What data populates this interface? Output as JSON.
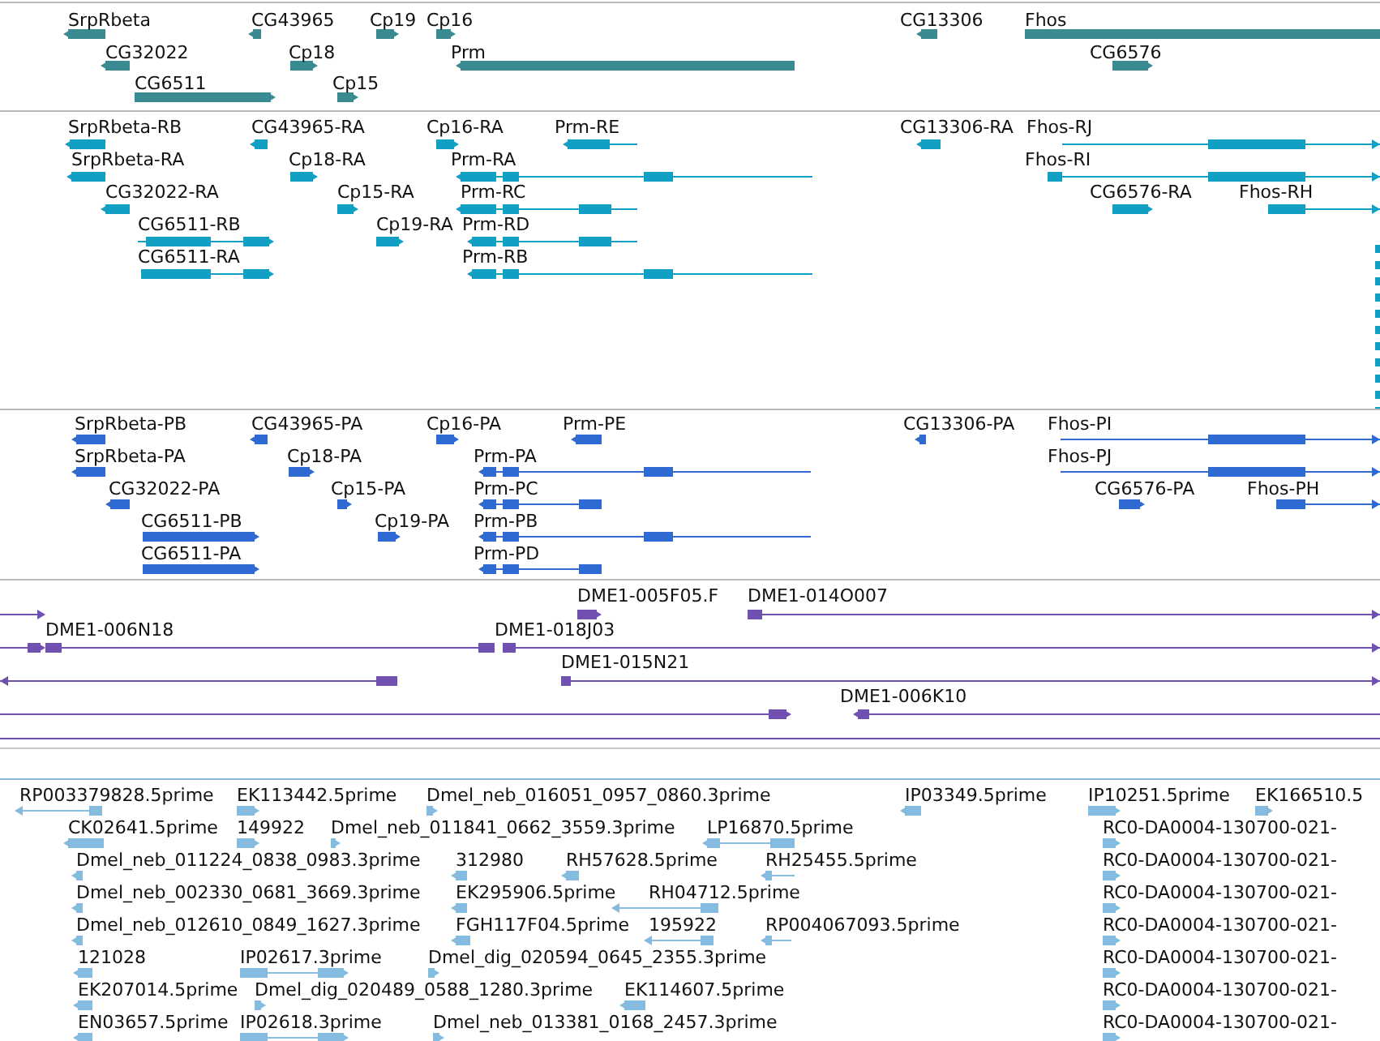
{
  "tracks": [
    {
      "color": "#3a8a92",
      "features": [
        {
          "label": "SrpRbeta",
          "reverse": true
        },
        {
          "label": "CG43965",
          "reverse": true
        },
        {
          "label": "Cp19",
          "reverse": false
        },
        {
          "label": "Cp16",
          "reverse": false
        },
        {
          "label": "CG13306",
          "reverse": true
        },
        {
          "label": "Fhos",
          "reverse": false
        },
        {
          "label": "CG32022",
          "reverse": true
        },
        {
          "label": "Cp18",
          "reverse": false
        },
        {
          "label": "Prm",
          "reverse": true
        },
        {
          "label": "CG6576",
          "reverse": false
        },
        {
          "label": "CG6511",
          "reverse": false
        },
        {
          "label": "Cp15",
          "reverse": false
        }
      ]
    },
    {
      "color": "#119fc4",
      "features": [
        {
          "label": "SrpRbeta-RB",
          "reverse": true
        },
        {
          "label": "CG43965-RA",
          "reverse": true
        },
        {
          "label": "Cp16-RA",
          "reverse": false
        },
        {
          "label": "Prm-RE",
          "reverse": true
        },
        {
          "label": "CG13306-RA",
          "reverse": true
        },
        {
          "label": "Fhos-RJ",
          "reverse": false
        },
        {
          "label": "SrpRbeta-RA",
          "reverse": true
        },
        {
          "label": "Cp18-RA",
          "reverse": false
        },
        {
          "label": "Prm-RA",
          "reverse": true
        },
        {
          "label": "Fhos-RI",
          "reverse": false
        },
        {
          "label": "CG32022-RA",
          "reverse": true
        },
        {
          "label": "Cp15-RA",
          "reverse": false
        },
        {
          "label": "Prm-RC",
          "reverse": true
        },
        {
          "label": "CG6576-RA",
          "reverse": false
        },
        {
          "label": "Fhos-RH",
          "reverse": false
        },
        {
          "label": "CG6511-RB",
          "reverse": false
        },
        {
          "label": "Cp19-RA",
          "reverse": false
        },
        {
          "label": "Prm-RD",
          "reverse": true
        },
        {
          "label": "CG6511-RA",
          "reverse": false
        },
        {
          "label": "Prm-RB",
          "reverse": true
        }
      ]
    },
    {
      "color": "#2f6ad2",
      "features": [
        {
          "label": "SrpRbeta-PB",
          "reverse": true
        },
        {
          "label": "CG43965-PA",
          "reverse": true
        },
        {
          "label": "Cp16-PA",
          "reverse": false
        },
        {
          "label": "Prm-PE",
          "reverse": true
        },
        {
          "label": "CG13306-PA",
          "reverse": true
        },
        {
          "label": "Fhos-PI",
          "reverse": false
        },
        {
          "label": "SrpRbeta-PA",
          "reverse": true
        },
        {
          "label": "Cp18-PA",
          "reverse": false
        },
        {
          "label": "Prm-PA",
          "reverse": true
        },
        {
          "label": "Fhos-PJ",
          "reverse": false
        },
        {
          "label": "CG32022-PA",
          "reverse": true
        },
        {
          "label": "Cp15-PA",
          "reverse": false
        },
        {
          "label": "Prm-PC",
          "reverse": true
        },
        {
          "label": "CG6576-PA",
          "reverse": false
        },
        {
          "label": "Fhos-PH",
          "reverse": false
        },
        {
          "label": "CG6511-PB",
          "reverse": false
        },
        {
          "label": "Cp19-PA",
          "reverse": false
        },
        {
          "label": "Prm-PB",
          "reverse": true
        },
        {
          "label": "CG6511-PA",
          "reverse": false
        },
        {
          "label": "Prm-PD",
          "reverse": true
        }
      ]
    },
    {
      "color": "#7050b0",
      "features": [
        {
          "reverse": false
        },
        {
          "label": "DME1-005F05.F",
          "reverse": false
        },
        {
          "label": "DME1-014O007",
          "reverse": false
        },
        {
          "reverse": false
        },
        {
          "label": "DME1-006N18",
          "reverse": false
        },
        {
          "label": "DME1-018J03",
          "reverse": false
        },
        {
          "reverse": true
        },
        {
          "label": "DME1-015N21",
          "reverse": false
        },
        {
          "reverse": false
        },
        {
          "label": "DME1-006K10",
          "reverse": true
        }
      ]
    },
    {
      "color": "#86bbe0",
      "features": [
        {
          "label": "RP003379828.5prime",
          "reverse": true
        },
        {
          "label": "EK113442.5prime",
          "reverse": false
        },
        {
          "label": "Dmel_neb_016051_0957_0860.3prime",
          "reverse": false
        },
        {
          "label": "IP03349.5prime",
          "reverse": true
        },
        {
          "label": "IP10251.5prime",
          "reverse": false
        },
        {
          "label": "EK166510.5",
          "reverse": false
        },
        {
          "label": "CK02641.5prime",
          "reverse": true
        },
        {
          "label": "149922",
          "reverse": false
        },
        {
          "label": "Dmel_neb_011841_0662_3559.3prime",
          "reverse": false
        },
        {
          "label": "LP16870.5prime",
          "reverse": true
        },
        {
          "label": "RC0-DA0004-130700-021-",
          "reverse": false
        },
        {
          "label": "Dmel_neb_011224_0838_0983.3prime",
          "reverse": true
        },
        {
          "label": "312980",
          "reverse": true
        },
        {
          "label": "RH57628.5prime",
          "reverse": true
        },
        {
          "label": "RH25455.5prime",
          "reverse": true
        },
        {
          "label": "RC0-DA0004-130700-021-",
          "reverse": false
        },
        {
          "label": "Dmel_neb_002330_0681_3669.3prime",
          "reverse": true
        },
        {
          "label": "EK295906.5prime",
          "reverse": true
        },
        {
          "label": "RH04712.5prime",
          "reverse": true
        },
        {
          "label": "RC0-DA0004-130700-021-",
          "reverse": false
        },
        {
          "label": "Dmel_neb_012610_0849_1627.3prime",
          "reverse": true
        },
        {
          "label": "FGH117F04.5prime",
          "reverse": true
        },
        {
          "label": "195922",
          "reverse": true
        },
        {
          "label": "RP004067093.5prime",
          "reverse": true
        },
        {
          "label": "RC0-DA0004-130700-021-",
          "reverse": false
        },
        {
          "label": "121028",
          "reverse": true
        },
        {
          "label": "IP02617.3prime",
          "reverse": false
        },
        {
          "label": "Dmel_dig_020594_0645_2355.3prime",
          "reverse": false
        },
        {
          "label": "RC0-DA0004-130700-021-",
          "reverse": false
        },
        {
          "label": "EK207014.5prime",
          "reverse": true
        },
        {
          "label": "Dmel_dig_020489_0588_1280.3prime",
          "reverse": false
        },
        {
          "label": "EK114607.5prime",
          "reverse": true
        },
        {
          "label": "RC0-DA0004-130700-021-",
          "reverse": false
        },
        {
          "label": "EN03657.5prime",
          "reverse": true
        },
        {
          "label": "IP02618.3prime",
          "reverse": false
        },
        {
          "label": "Dmel_neb_013381_0168_2457.3prime",
          "reverse": false
        },
        {
          "label": "RC0-DA0004-130700-021-",
          "reverse": false
        }
      ]
    }
  ]
}
